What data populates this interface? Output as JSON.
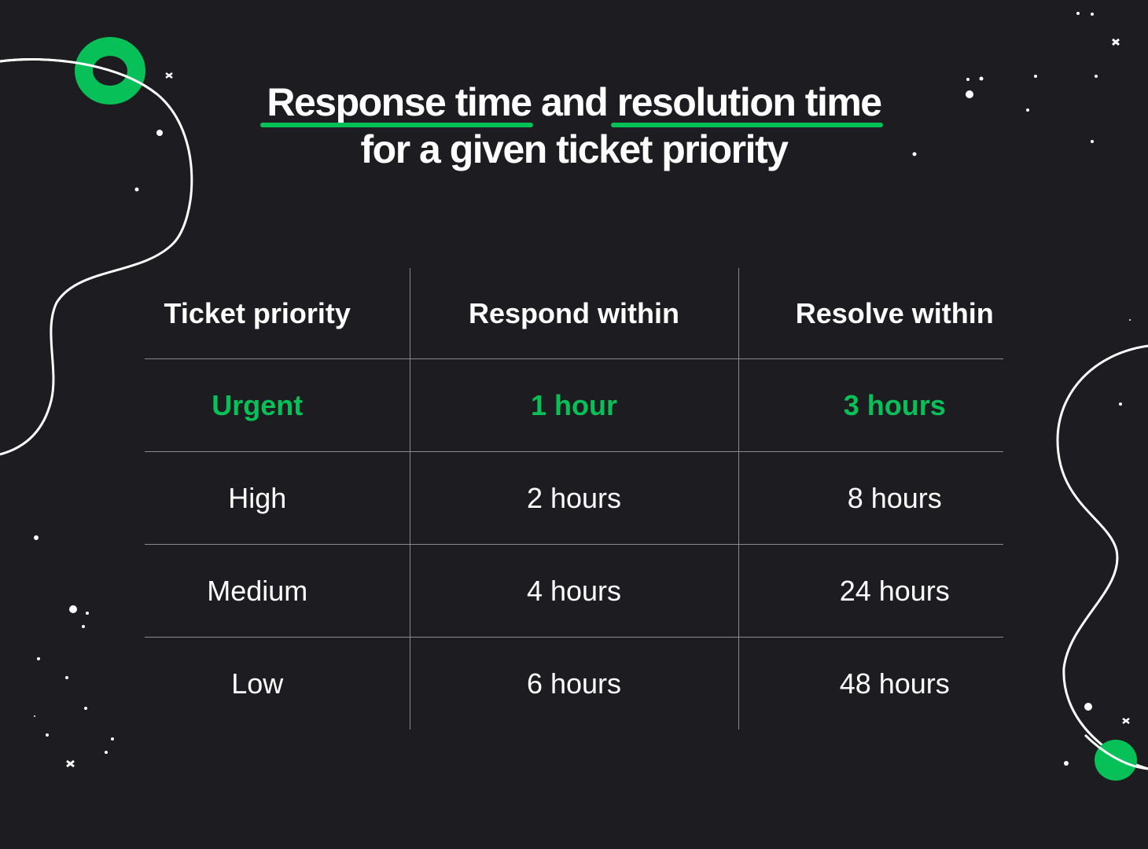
{
  "title": {
    "part1": "Response time",
    "part2": " and ",
    "part3": "resolution time",
    "line2": "for a given ticket priority"
  },
  "colors": {
    "background": "#1d1d21",
    "accent": "#07c158",
    "text": "#ffffff",
    "grid": "#8a8a8d"
  },
  "table": {
    "headers": [
      "Ticket priority",
      "Respond within",
      "Resolve within"
    ],
    "rows": [
      {
        "priority": "Urgent",
        "respond": "1 hour",
        "resolve": "3 hours",
        "highlight": true
      },
      {
        "priority": "High",
        "respond": "2 hours",
        "resolve": "8 hours",
        "highlight": false
      },
      {
        "priority": "Medium",
        "respond": "4 hours",
        "resolve": "24 hours",
        "highlight": false
      },
      {
        "priority": "Low",
        "respond": "6 hours",
        "resolve": "48 hours",
        "highlight": false
      }
    ]
  }
}
